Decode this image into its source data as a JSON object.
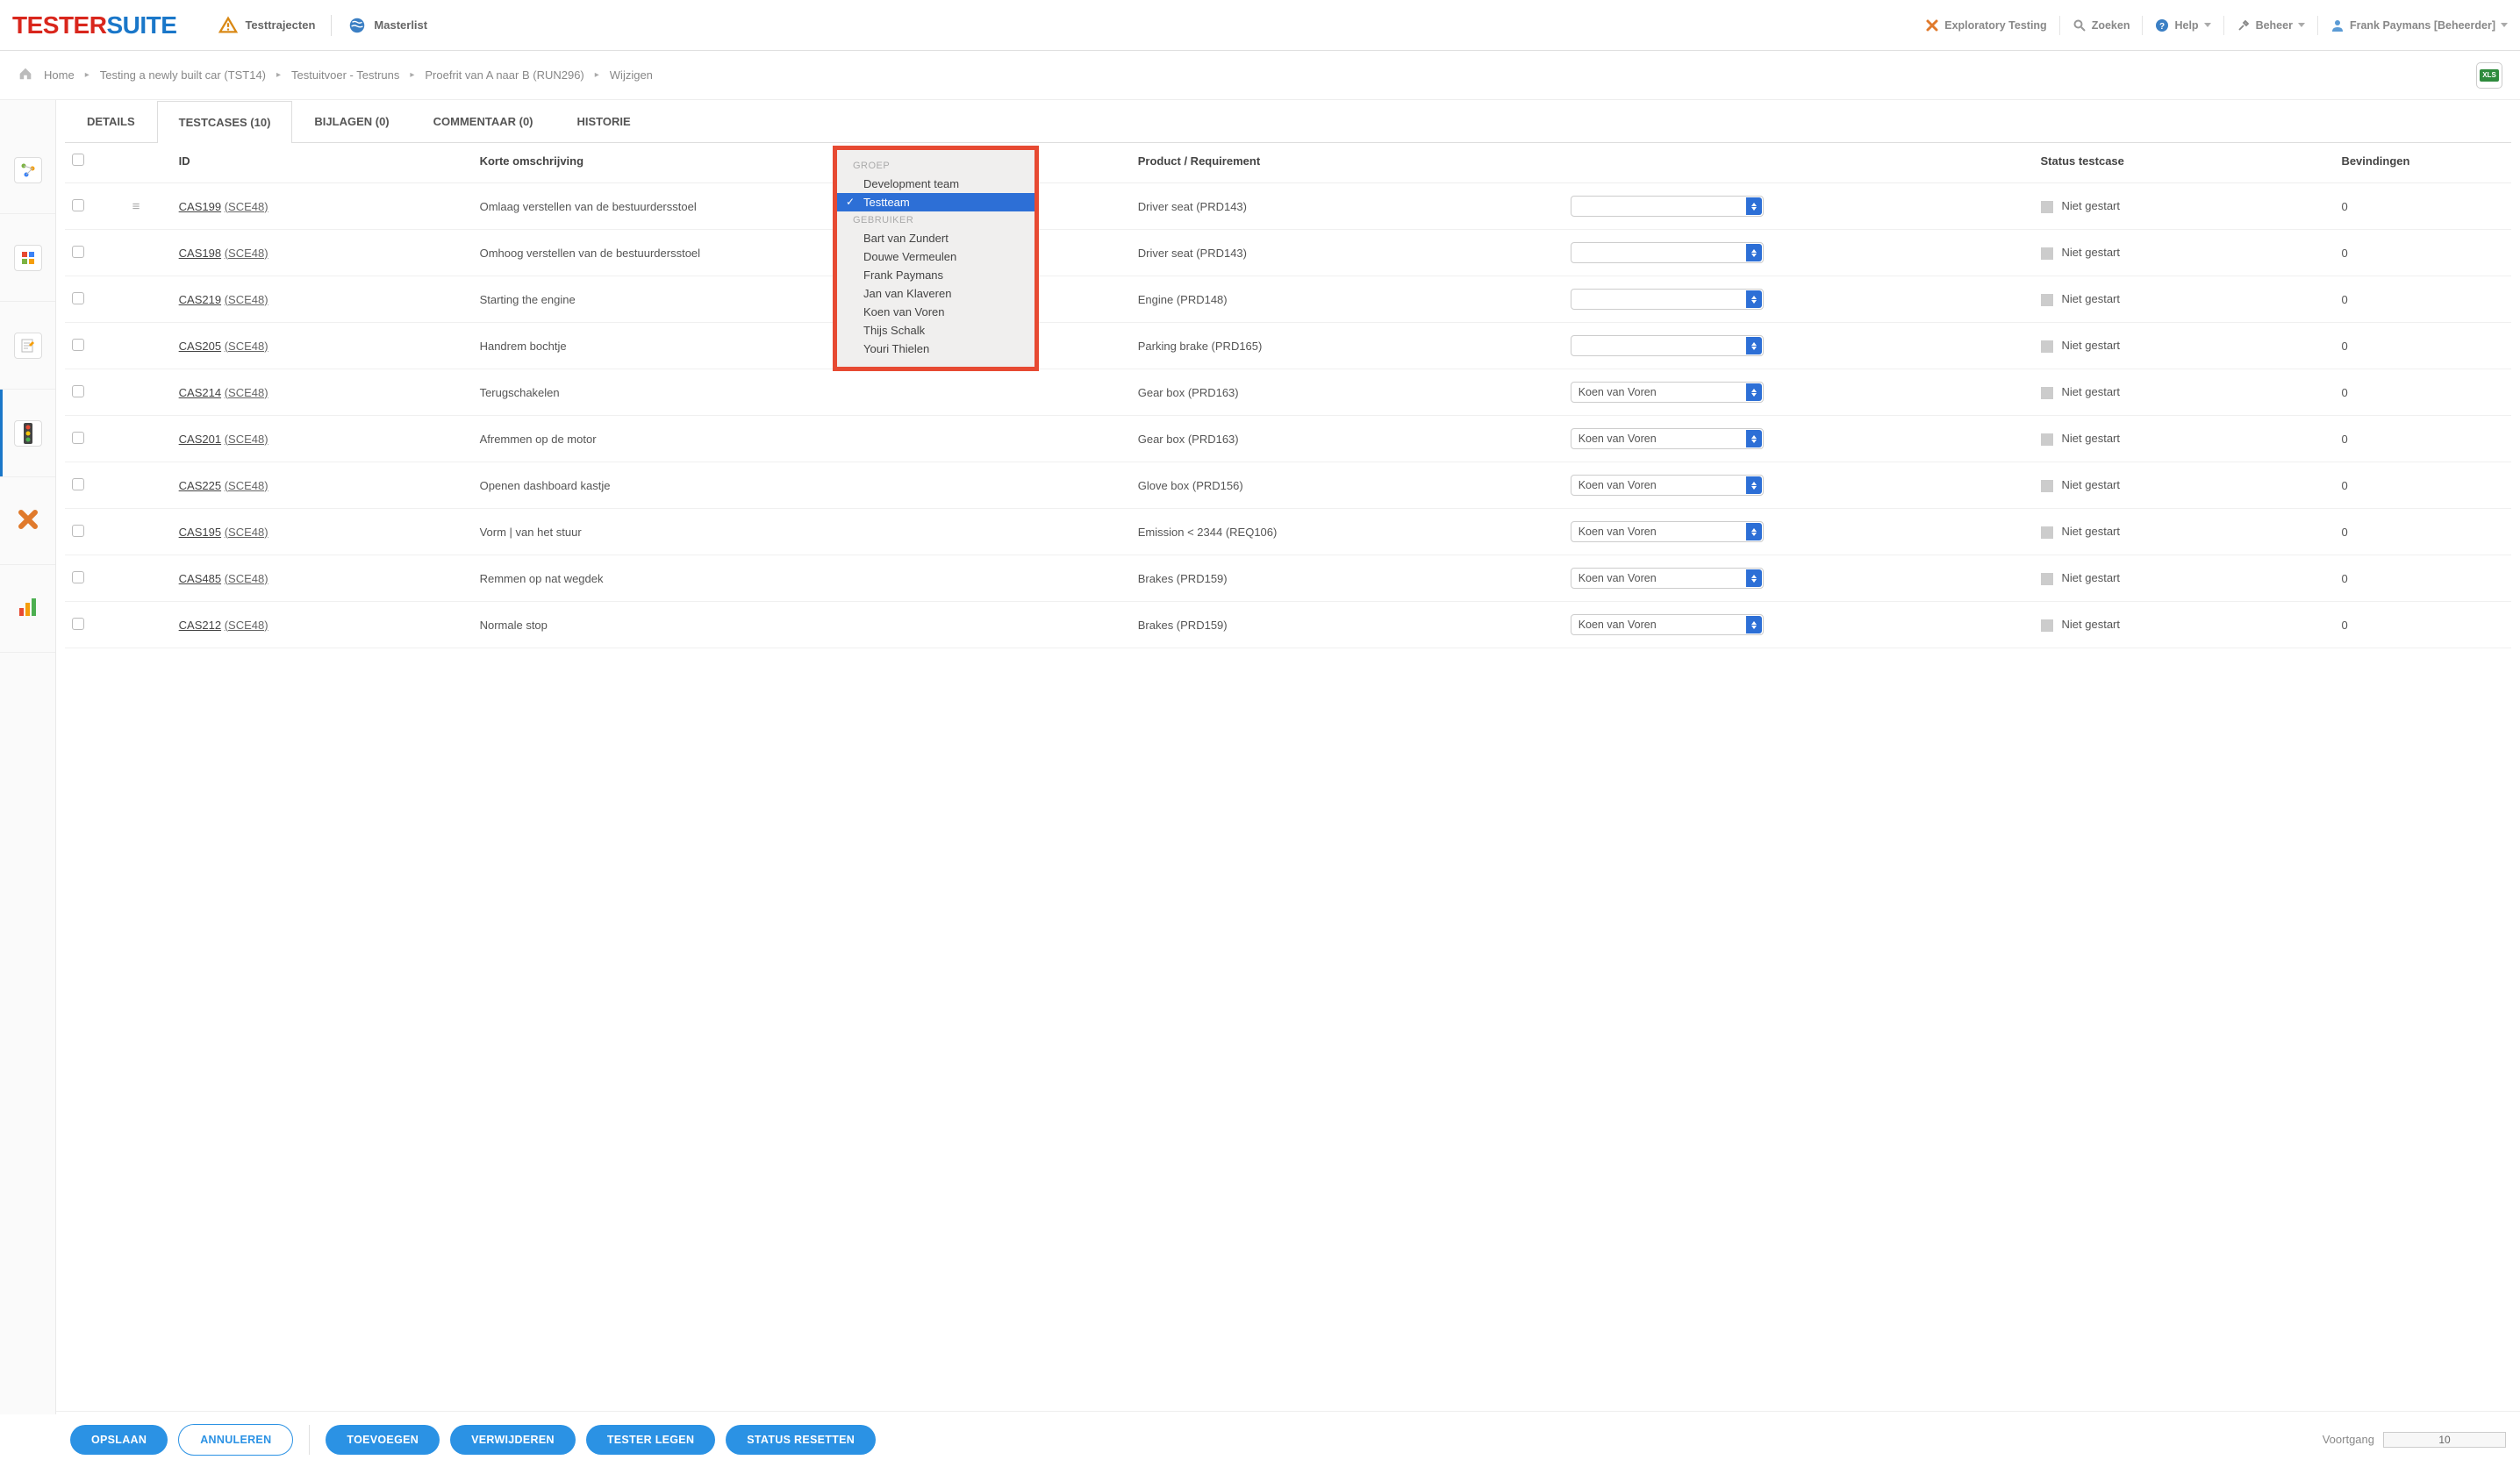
{
  "logo": {
    "part1": "TESTER",
    "part2": "SUITE"
  },
  "topnav": {
    "trajecten": "Testtrajecten",
    "masterlist": "Masterlist"
  },
  "topright": {
    "exploratory": "Exploratory Testing",
    "zoeken": "Zoeken",
    "help": "Help",
    "beheer": "Beheer",
    "user": "Frank Paymans [Beheerder]"
  },
  "breadcrumb": {
    "home": "Home",
    "b1": "Testing a newly built car (TST14)",
    "b2": "Testuitvoer - Testruns",
    "b3": "Proefrit van A naar B (RUN296)",
    "b4": "Wijzigen"
  },
  "xls": "XLS",
  "tabs": {
    "details": "DETAILS",
    "testcases": "TESTCASES (10)",
    "bijlagen": "BIJLAGEN (0)",
    "commentaar": "COMMENTAAR (0)",
    "historie": "HISTORIE"
  },
  "cols": {
    "id": "ID",
    "desc": "Korte omschrijving",
    "product": "Product / Requirement",
    "status": "Status testcase",
    "find": "Bevindingen"
  },
  "rows": [
    {
      "id": "CAS199",
      "sce": "(SCE48)",
      "desc": "Omlaag verstellen van de bestuurdersstoel",
      "prod": "Driver seat (PRD143)",
      "tester": "",
      "status": "Niet gestart",
      "find": "0"
    },
    {
      "id": "CAS198",
      "sce": "(SCE48)",
      "desc": "Omhoog verstellen van de bestuurdersstoel",
      "prod": "Driver seat (PRD143)",
      "tester": "",
      "status": "Niet gestart",
      "find": "0"
    },
    {
      "id": "CAS219",
      "sce": "(SCE48)",
      "desc": "Starting the engine",
      "prod": "Engine (PRD148)",
      "tester": "",
      "status": "Niet gestart",
      "find": "0"
    },
    {
      "id": "CAS205",
      "sce": "(SCE48)",
      "desc": "Handrem bochtje",
      "prod": "Parking brake (PRD165)",
      "tester": "",
      "status": "Niet gestart",
      "find": "0"
    },
    {
      "id": "CAS214",
      "sce": "(SCE48)",
      "desc": "Terugschakelen",
      "prod": "Gear box (PRD163)",
      "tester": "Koen van Voren",
      "status": "Niet gestart",
      "find": "0"
    },
    {
      "id": "CAS201",
      "sce": "(SCE48)",
      "desc": "Afremmen op de motor",
      "prod": "Gear box (PRD163)",
      "tester": "Koen van Voren",
      "status": "Niet gestart",
      "find": "0"
    },
    {
      "id": "CAS225",
      "sce": "(SCE48)",
      "desc": "Openen dashboard kastje",
      "prod": "Glove box (PRD156)",
      "tester": "Koen van Voren",
      "status": "Niet gestart",
      "find": "0"
    },
    {
      "id": "CAS195",
      "sce": "(SCE48)",
      "desc": "Vorm | van het stuur",
      "prod": "Emission < 2344 (REQ106)",
      "tester": "Koen van Voren",
      "status": "Niet gestart",
      "find": "0"
    },
    {
      "id": "CAS485",
      "sce": "(SCE48)",
      "desc": "Remmen op nat wegdek",
      "prod": "Brakes (PRD159)",
      "tester": "Koen van Voren",
      "status": "Niet gestart",
      "find": "0"
    },
    {
      "id": "CAS212",
      "sce": "(SCE48)",
      "desc": "Normale stop",
      "prod": "Brakes (PRD159)",
      "tester": "Koen van Voren",
      "status": "Niet gestart",
      "find": "0"
    }
  ],
  "dropdown": {
    "group_label": "GROEP",
    "groups": [
      "Development team",
      "Testteam"
    ],
    "selected_group": "Testteam",
    "user_label": "GEBRUIKER",
    "users": [
      "Bart van Zundert",
      "Douwe Vermeulen",
      "Frank Paymans",
      "Jan van Klaveren",
      "Koen van Voren",
      "Thijs Schalk",
      "Youri Thielen"
    ]
  },
  "footer": {
    "opslaan": "OPSLAAN",
    "annuleren": "ANNULEREN",
    "toevoegen": "TOEVOEGEN",
    "verwijderen": "VERWIJDEREN",
    "testerlegen": "TESTER LEGEN",
    "statusreset": "STATUS RESETTEN",
    "voortgang": "Voortgang",
    "voortgang_val": "10"
  }
}
